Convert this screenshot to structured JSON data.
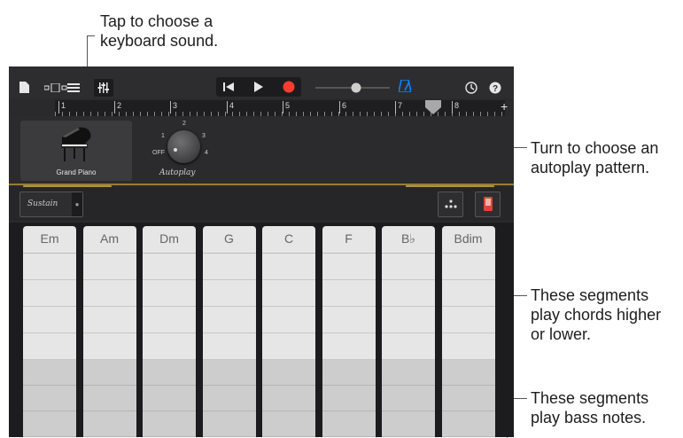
{
  "callouts": {
    "keyboard_sound": [
      "Tap to choose a",
      "keyboard sound."
    ],
    "autoplay_pattern": [
      "Turn to choose an",
      "autoplay pattern."
    ],
    "chord_segments": [
      "These segments",
      "play chords higher",
      "or lower."
    ],
    "bass_segments": [
      "These segments",
      "play bass notes."
    ]
  },
  "ruler": {
    "bars": [
      "1",
      "2",
      "3",
      "4",
      "5",
      "6",
      "7",
      "8"
    ],
    "add_label": "+"
  },
  "instrument": {
    "name": "Grand Piano"
  },
  "autoplay": {
    "label": "Autoplay",
    "positions": [
      "OFF",
      "1",
      "2",
      "3",
      "4"
    ],
    "selected": "OFF"
  },
  "sustain": {
    "label": "Sustain"
  },
  "chords": [
    "Em",
    "Am",
    "Dm",
    "G",
    "C",
    "F",
    "B♭",
    "Bdim"
  ],
  "colors": {
    "record": "#ff3b30",
    "metronome": "#0a84ff",
    "accent": "#9a7b3b",
    "toggle": "#e0433a"
  },
  "icons": [
    "document-icon",
    "tracks-view-icon",
    "list-view-icon",
    "mixer-icon",
    "rewind-icon",
    "play-icon",
    "record-icon",
    "volume-slider",
    "metronome-icon",
    "settings-icon",
    "help-icon"
  ]
}
